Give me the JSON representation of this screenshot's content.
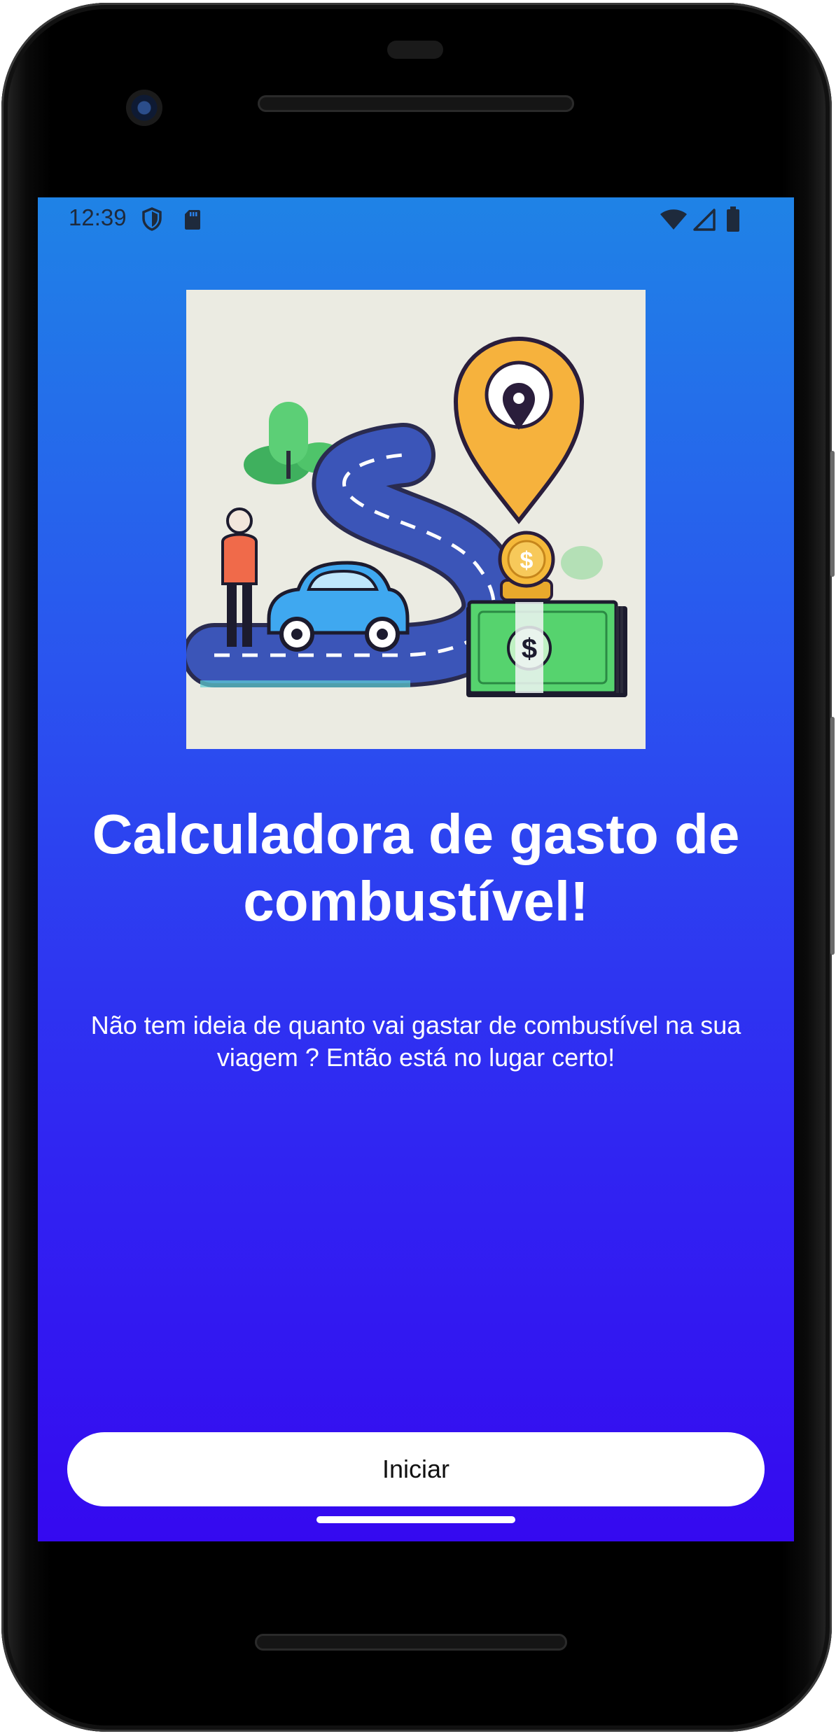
{
  "status_bar": {
    "time": "12:39",
    "icons": [
      "shield-icon",
      "sd-card-icon",
      "wifi-icon",
      "cellular-signal-icon",
      "battery-icon"
    ]
  },
  "hero_image": {
    "icon_names": [
      "person-icon",
      "car-icon",
      "road-icon",
      "map-pin-icon",
      "coin-icon",
      "money-bills-icon",
      "tree-icon"
    ]
  },
  "main": {
    "title": "Calculadora de gasto de combustível!",
    "subtitle": "Não tem ideia de quanto vai gastar de combustível na sua viagem ? Então está no lugar certo!",
    "start_button": "Iniciar"
  },
  "colors": {
    "gradient_top": "#1f83e6",
    "gradient_bottom": "#3509f0",
    "button_bg": "#ffffff",
    "text_light": "#ffffff"
  }
}
